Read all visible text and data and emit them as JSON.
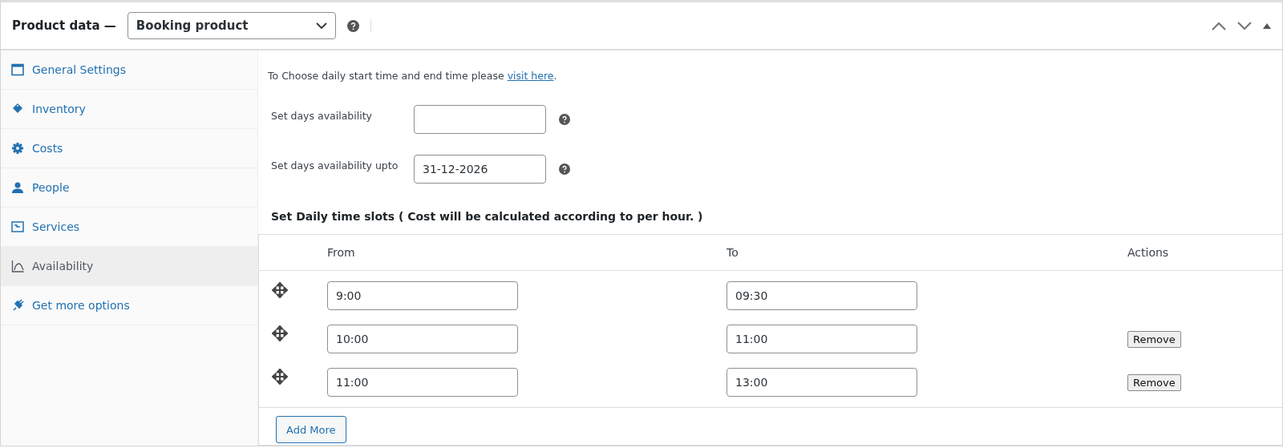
{
  "header": {
    "title": "Product data —",
    "product_type": "Booking product"
  },
  "sidebar": {
    "items": [
      {
        "label": "General Settings",
        "selected": false
      },
      {
        "label": "Inventory",
        "selected": false
      },
      {
        "label": "Costs",
        "selected": false
      },
      {
        "label": "People",
        "selected": false
      },
      {
        "label": "Services",
        "selected": false
      },
      {
        "label": "Availability",
        "selected": true
      },
      {
        "label": "Get more options",
        "selected": false
      }
    ]
  },
  "intro": {
    "text": "To Choose daily start time and end time please ",
    "link": "visit here",
    "after": "."
  },
  "fields": [
    {
      "label": "Set days availability"
    },
    {
      "label": "Set days availability upto",
      "value": "31-12-2026"
    }
  ],
  "slots_heading": "Set Daily time slots ( Cost will be calculated according to per hour. )",
  "table": {
    "columns": [
      "From",
      "To",
      "Actions"
    ],
    "rows": [
      {
        "from": "9:00",
        "to": "09:30"
      },
      {
        "from": "10:00",
        "to": "11:00",
        "action": "Remove"
      },
      {
        "from": "11:00",
        "to": "13:00",
        "action": "Remove"
      }
    ]
  },
  "add_button": "Add More"
}
